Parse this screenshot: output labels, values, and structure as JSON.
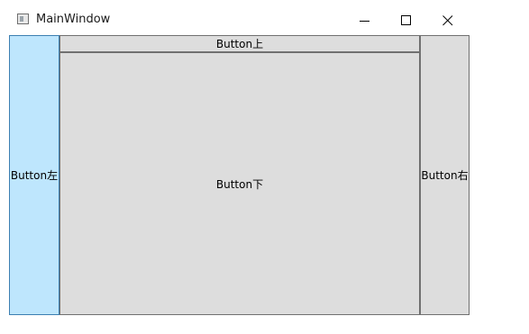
{
  "window": {
    "title": "MainWindow",
    "controls": {
      "minimize": "minimize",
      "maximize": "maximize",
      "close": "close"
    }
  },
  "buttons": {
    "left": "Button左",
    "top": "Button上",
    "bottom": "Button下",
    "right": "Button右"
  },
  "colors": {
    "hover_fill": "#bee6fd",
    "hover_border": "#3c7fb1",
    "button_fill": "#dddddd",
    "button_border": "#707070"
  }
}
